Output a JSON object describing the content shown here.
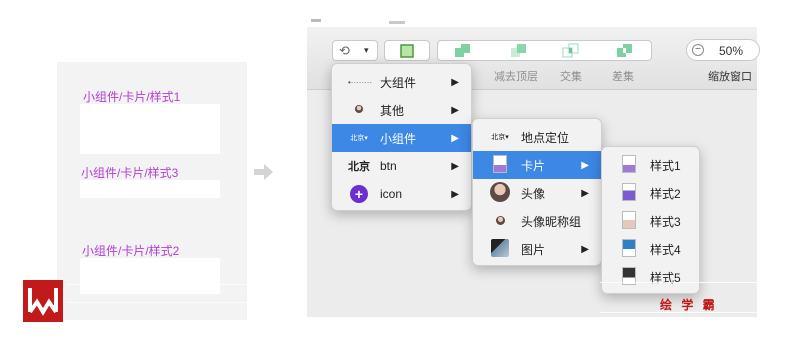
{
  "canvas": {
    "labels": [
      "小组件/卡片/样式1",
      "小组件/卡片/样式3",
      "小组件/卡片/样式2"
    ]
  },
  "toolbar": {
    "labels": [
      "减去顶层",
      "交集",
      "差集"
    ],
    "zoom_value": "50%",
    "zoom_caption": "缩放窗口"
  },
  "menu1": {
    "items": [
      {
        "thumb": "•········",
        "label": "大组件",
        "arrow": "▶"
      },
      {
        "thumb": "",
        "label": "其他",
        "arrow": "▶"
      },
      {
        "thumb": "北京▾",
        "label": "小组件",
        "arrow": "▶"
      },
      {
        "thumb": "北京",
        "label": "btn",
        "arrow": "▶"
      },
      {
        "thumb": "+",
        "label": "icon",
        "arrow": "▶"
      }
    ]
  },
  "menu2": {
    "items": [
      {
        "thumb": "北京▾",
        "label": "地点定位"
      },
      {
        "label": "卡片",
        "arrow": "▶"
      },
      {
        "label": "头像",
        "arrow": "▶"
      },
      {
        "label": "头像昵称组"
      },
      {
        "label": "图片",
        "arrow": "▶"
      }
    ]
  },
  "menu3": {
    "items": [
      {
        "label": "样式1"
      },
      {
        "label": "样式2"
      },
      {
        "label": "样式3"
      },
      {
        "label": "样式4"
      },
      {
        "label": "样式5"
      }
    ]
  },
  "watermark": {
    "brand": "绘 学 霸"
  },
  "colors": {
    "selection": "#3d87e5",
    "artboard_label": "#b43fd4",
    "brand_red": "#c21a1a",
    "icon_purple": "#6b2fd1"
  }
}
